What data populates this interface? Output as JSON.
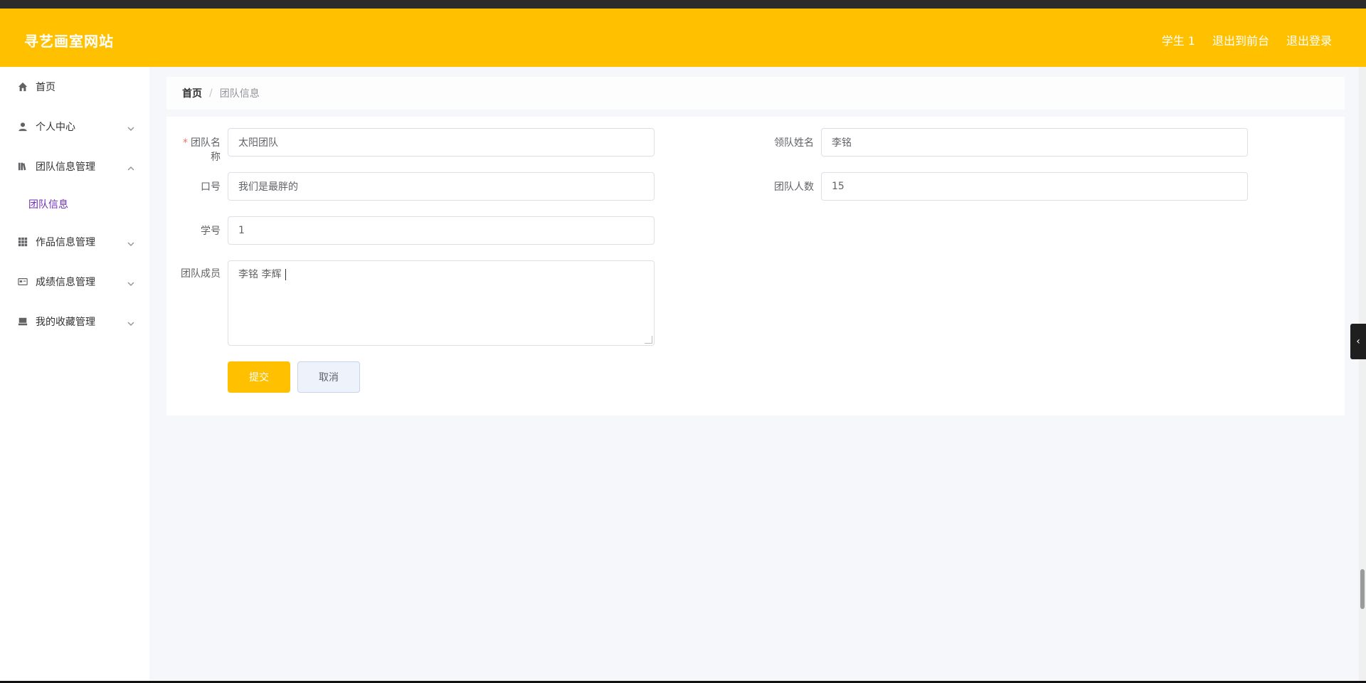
{
  "header": {
    "brand": "寻艺画室网站",
    "links": [
      "学生 1",
      "退出到前台",
      "退出登录"
    ]
  },
  "sidebar": {
    "items": [
      {
        "label": "首页",
        "icon": "home-icon"
      },
      {
        "label": "个人中心",
        "icon": "user-icon",
        "expanded": false
      },
      {
        "label": "团队信息管理",
        "icon": "books-icon",
        "expanded": true,
        "children": [
          "团队信息"
        ]
      },
      {
        "label": "作品信息管理",
        "icon": "grid-icon",
        "expanded": false
      },
      {
        "label": "成绩信息管理",
        "icon": "card-icon",
        "expanded": false
      },
      {
        "label": "我的收藏管理",
        "icon": "tray-icon",
        "expanded": false
      }
    ]
  },
  "breadcrumb": {
    "home": "首页",
    "separator": "/",
    "current": "团队信息"
  },
  "form": {
    "team_name": {
      "label": "团队名称",
      "value": "太阳团队",
      "required": true
    },
    "leader_name": {
      "label": "领队姓名",
      "value": "李铭"
    },
    "slogan": {
      "label": "口号",
      "value": "我们是最胖的"
    },
    "team_size": {
      "label": "团队人数",
      "value": "15"
    },
    "student_no": {
      "label": "学号",
      "value": "1"
    },
    "members": {
      "label": "团队成员",
      "value": "李铭  李辉"
    },
    "submit_label": "提交",
    "cancel_label": "取消"
  },
  "colors": {
    "accent": "#ffc000",
    "active_submenu": "#6f2fb7",
    "required": "#f56c6c"
  }
}
